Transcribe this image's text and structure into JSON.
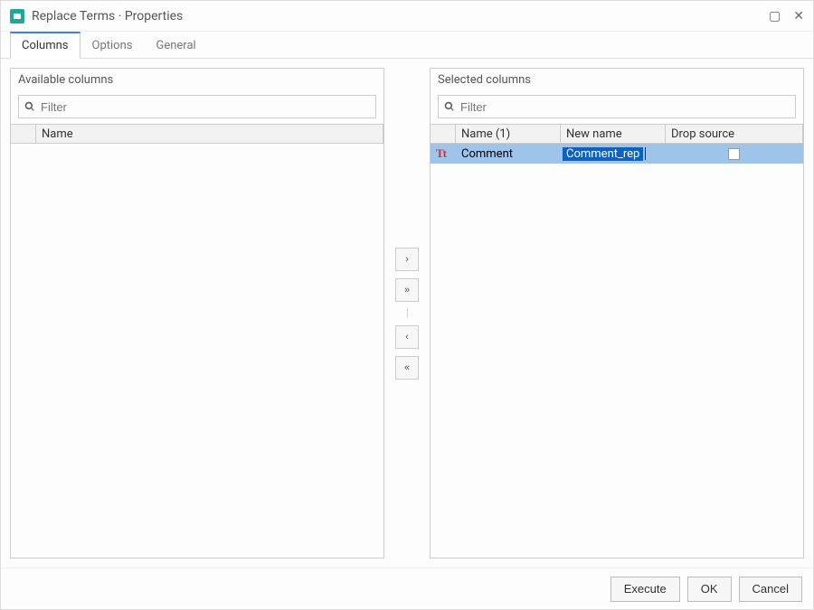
{
  "window": {
    "title": "Replace Terms · Properties"
  },
  "tabs": {
    "columns": "Columns",
    "options": "Options",
    "general": "General"
  },
  "left": {
    "title": "Available columns",
    "filter_placeholder": "Filter",
    "header_name": "Name"
  },
  "right": {
    "title": "Selected columns",
    "filter_placeholder": "Filter",
    "header_name": "Name (1)",
    "header_newname": "New name",
    "header_drop": "Drop source",
    "rows": [
      {
        "name": "Comment",
        "new_name": "Comment_rep",
        "drop": false
      }
    ]
  },
  "transfer": {
    "add": "›",
    "add_all": "»",
    "remove": "‹",
    "remove_all": "«"
  },
  "buttons": {
    "execute": "Execute",
    "ok": "OK",
    "cancel": "Cancel"
  },
  "icons": {
    "text_type": "Tt"
  }
}
